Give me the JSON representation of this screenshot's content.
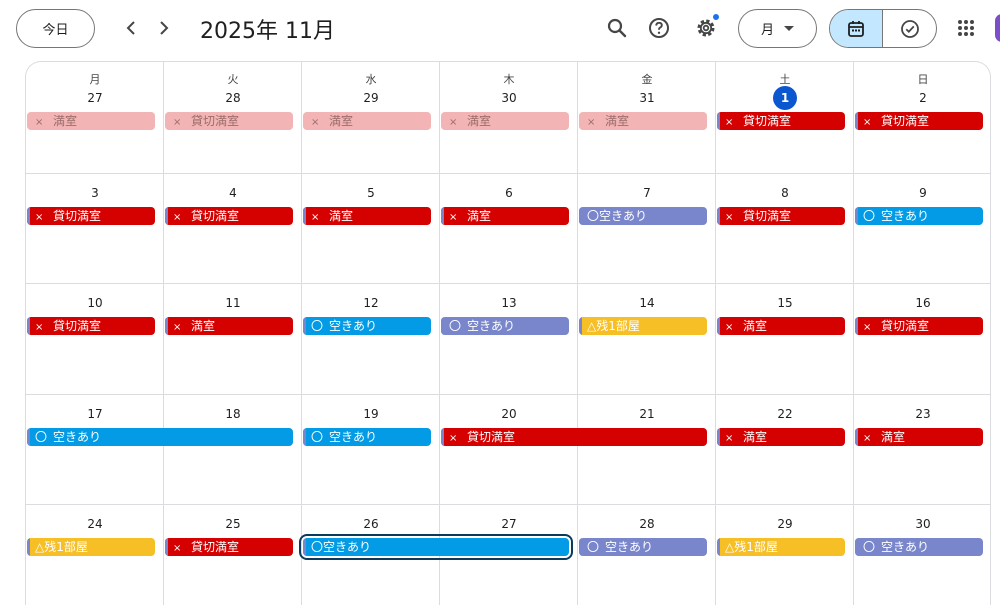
{
  "header": {
    "today_label": "今日",
    "title": "2025年 11月",
    "view_label": "月",
    "icons": [
      "search-icon",
      "help-icon",
      "settings-icon",
      "calendar-icon",
      "task-check-icon",
      "apps-grid-icon"
    ]
  },
  "weekdays": [
    "月",
    "火",
    "水",
    "木",
    "金",
    "土",
    "日"
  ],
  "weeks": [
    [
      "27",
      "28",
      "29",
      "30",
      "31",
      "1",
      "2"
    ],
    [
      "3",
      "4",
      "5",
      "6",
      "7",
      "8",
      "9"
    ],
    [
      "10",
      "11",
      "12",
      "13",
      "14",
      "15",
      "16"
    ],
    [
      "17",
      "18",
      "19",
      "20",
      "21",
      "22",
      "23"
    ],
    [
      "24",
      "25",
      "26",
      "27",
      "28",
      "29",
      "30"
    ]
  ],
  "today": "1",
  "colors": {
    "full": "#d50000",
    "available": "#039be5",
    "lavender": "#7986cb",
    "few_left": "#f6bf26",
    "past": "#f2b4b4",
    "today": "#0b57d0"
  },
  "events": [
    {
      "week": 0,
      "col": 0,
      "span": 1,
      "mark": "×",
      "text": "満室",
      "style": "past"
    },
    {
      "week": 0,
      "col": 1,
      "span": 1,
      "mark": "×",
      "text": "貸切満室",
      "style": "past"
    },
    {
      "week": 0,
      "col": 2,
      "span": 1,
      "mark": "×",
      "text": "満室",
      "style": "past"
    },
    {
      "week": 0,
      "col": 3,
      "span": 1,
      "mark": "×",
      "text": "満室",
      "style": "past"
    },
    {
      "week": 0,
      "col": 4,
      "span": 1,
      "mark": "×",
      "text": "満室",
      "style": "past"
    },
    {
      "week": 0,
      "col": 5,
      "span": 1,
      "mark": "×",
      "text": "貸切満室",
      "style": "full"
    },
    {
      "week": 0,
      "col": 6,
      "span": 1,
      "mark": "×",
      "text": "貸切満室",
      "style": "full"
    },
    {
      "week": 1,
      "col": 0,
      "span": 1,
      "mark": "×",
      "text": "貸切満室",
      "style": "full"
    },
    {
      "week": 1,
      "col": 1,
      "span": 1,
      "mark": "×",
      "text": "貸切満室",
      "style": "full"
    },
    {
      "week": 1,
      "col": 2,
      "span": 1,
      "mark": "×",
      "text": "満室",
      "style": "full"
    },
    {
      "week": 1,
      "col": 3,
      "span": 1,
      "mark": "×",
      "text": "満室",
      "style": "full"
    },
    {
      "week": 1,
      "col": 4,
      "span": 1,
      "mark": "",
      "text": "〇空きあり",
      "style": "lav"
    },
    {
      "week": 1,
      "col": 5,
      "span": 1,
      "mark": "×",
      "text": "貸切満室",
      "style": "full"
    },
    {
      "week": 1,
      "col": 6,
      "span": 1,
      "mark": "〇",
      "text": "空きあり",
      "style": "blue"
    },
    {
      "week": 2,
      "col": 0,
      "span": 1,
      "mark": "×",
      "text": "貸切満室",
      "style": "full"
    },
    {
      "week": 2,
      "col": 1,
      "span": 1,
      "mark": "×",
      "text": "満室",
      "style": "full"
    },
    {
      "week": 2,
      "col": 2,
      "span": 1,
      "mark": "〇",
      "text": "空きあり",
      "style": "blue"
    },
    {
      "week": 2,
      "col": 3,
      "span": 1,
      "mark": "〇",
      "text": "空きあり",
      "style": "lav"
    },
    {
      "week": 2,
      "col": 4,
      "span": 1,
      "mark": "",
      "text": "△残1部屋",
      "style": "yel"
    },
    {
      "week": 2,
      "col": 5,
      "span": 1,
      "mark": "×",
      "text": "満室",
      "style": "full"
    },
    {
      "week": 2,
      "col": 6,
      "span": 1,
      "mark": "×",
      "text": "貸切満室",
      "style": "full"
    },
    {
      "week": 3,
      "col": 0,
      "span": 2,
      "mark": "〇",
      "text": "空きあり",
      "style": "blue"
    },
    {
      "week": 3,
      "col": 2,
      "span": 1,
      "mark": "〇",
      "text": "空きあり",
      "style": "blue"
    },
    {
      "week": 3,
      "col": 3,
      "span": 2,
      "mark": "×",
      "text": "貸切満室",
      "style": "full"
    },
    {
      "week": 3,
      "col": 5,
      "span": 1,
      "mark": "×",
      "text": "満室",
      "style": "full"
    },
    {
      "week": 3,
      "col": 6,
      "span": 1,
      "mark": "×",
      "text": "満室",
      "style": "full"
    },
    {
      "week": 4,
      "col": 0,
      "span": 1,
      "mark": "",
      "text": "△残1部屋",
      "style": "yel"
    },
    {
      "week": 4,
      "col": 1,
      "span": 1,
      "mark": "×",
      "text": "貸切満室",
      "style": "full"
    },
    {
      "week": 4,
      "col": 2,
      "span": 2,
      "mark": "",
      "text": "〇空きあり",
      "style": "blue",
      "selected": true
    },
    {
      "week": 4,
      "col": 4,
      "span": 1,
      "mark": "〇",
      "text": "空きあり",
      "style": "lav"
    },
    {
      "week": 4,
      "col": 5,
      "span": 1,
      "mark": "",
      "text": "△残1部屋",
      "style": "yel"
    },
    {
      "week": 4,
      "col": 6,
      "span": 1,
      "mark": "〇",
      "text": "空きあり",
      "style": "lav"
    }
  ]
}
